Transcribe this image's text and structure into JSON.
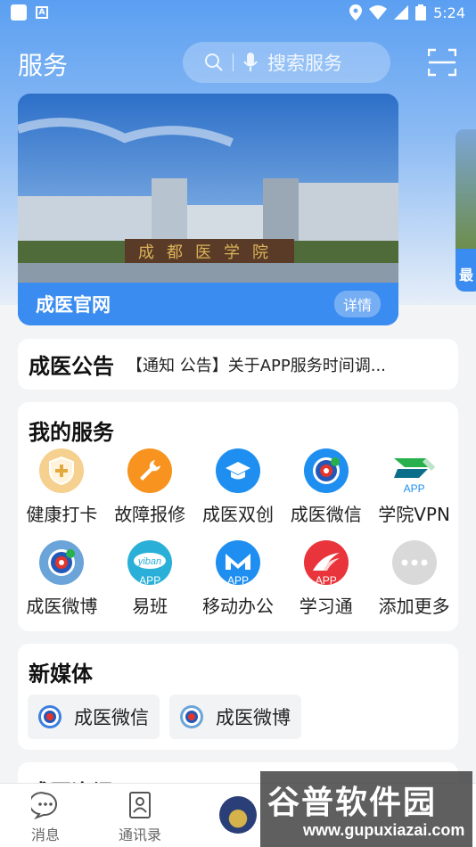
{
  "status_bar": {
    "time": "5:24"
  },
  "header": {
    "title": "服务",
    "search_placeholder": "搜索服务"
  },
  "banner": {
    "title": "成医官网",
    "more": "详情",
    "sign_text": "成都医学院",
    "next_peek": "最"
  },
  "notice": {
    "label": "成医公告",
    "text": "【通知 公告】关于APP服务时间调..."
  },
  "my_services": {
    "title": "我的服务",
    "items": [
      {
        "label": "健康打卡",
        "icon": "shield-plus-icon",
        "color": "#f3c77a"
      },
      {
        "label": "故障报修",
        "icon": "wrench-icon",
        "color": "#f7931e"
      },
      {
        "label": "成医双创",
        "icon": "graduation-cap-icon",
        "color": "#1e8ff0"
      },
      {
        "label": "成医微信",
        "icon": "school-logo-icon",
        "color": "#1e8ff0"
      },
      {
        "label": "学院VPN",
        "icon": "vpn-app-icon",
        "color": "#22a667",
        "app_tag": "APP"
      },
      {
        "label": "成医微博",
        "icon": "school-logo-icon",
        "color": "#5aa0e0"
      },
      {
        "label": "易班",
        "icon": "yiban-app-icon",
        "color": "#2ab0d8",
        "app_tag": "APP",
        "inner": "yiban"
      },
      {
        "label": "移动办公",
        "icon": "m-app-icon",
        "color": "#1e8ff0",
        "app_tag": "APP"
      },
      {
        "label": "学习通",
        "icon": "xuexitong-app-icon",
        "color": "#e8343a",
        "app_tag": "APP"
      },
      {
        "label": "添加更多",
        "icon": "more-dots-icon",
        "color": "#d9d9d9"
      }
    ]
  },
  "new_media": {
    "title": "新媒体",
    "items": [
      {
        "label": "成医微信"
      },
      {
        "label": "成医微博"
      }
    ]
  },
  "next_section": {
    "title": "成医资讯"
  },
  "bottom_nav": {
    "items": [
      {
        "label": "消息"
      },
      {
        "label": "通讯录"
      }
    ]
  },
  "watermark": {
    "text": "谷普软件园",
    "url": "www.gupuxiazai.com"
  }
}
